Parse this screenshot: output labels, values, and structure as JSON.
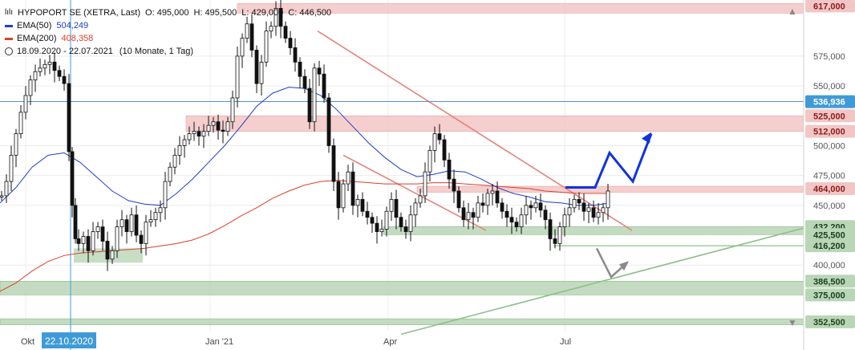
{
  "legend": {
    "logo": "lılı",
    "symbol": "HYPOPORT SE (XETRA, Last)",
    "open": "O: 495,000",
    "high": "H: 495,500",
    "low": "L: 429,000",
    "close": "C: 446,500",
    "ema50_label": "EMA(50)",
    "ema50_value": "504,249",
    "ema200_label": "EMA(200)",
    "ema200_value": "408,358",
    "date_range": "18.09.2020 - 22.07.2021",
    "period": "(10 Monate, 1 Tag)"
  },
  "colors": {
    "ema50": "#1f3fbf",
    "ema200": "#d9402a",
    "resistance_zone": "#f3c6c6",
    "support_zone": "#b9d6b6",
    "trend_red": "#e2857c",
    "trend_green": "#8fbf8a",
    "forecast_arrow": "#1133dd",
    "gray_arrow": "#8a8a8a",
    "candle": "#111111",
    "highlight_label": "#3f9bd8"
  },
  "chart_data": {
    "type": "candlestick",
    "x_ticks": [
      "Okt",
      "Jan '21",
      "Apr",
      "Jul"
    ],
    "crosshair_date": "22.10.2020",
    "y_ticks": [
      "575,000",
      "550,000",
      "500,000",
      "475,000",
      "450,000",
      "400,000"
    ],
    "y_range": [
      345,
      622
    ],
    "price_labels": [
      {
        "text": "617,000",
        "value": 617,
        "style": "red"
      },
      {
        "text": "536,936",
        "value": 536.9,
        "style": "blue"
      },
      {
        "text": "525,000",
        "value": 525,
        "style": "red"
      },
      {
        "text": "512,000",
        "value": 512,
        "style": "red"
      },
      {
        "text": "464,000",
        "value": 464,
        "style": "red"
      },
      {
        "text": "432,200",
        "value": 432.2,
        "style": "green"
      },
      {
        "text": "425,500",
        "value": 425.5,
        "style": "green"
      },
      {
        "text": "416,200",
        "value": 416.2,
        "style": "green"
      },
      {
        "text": "386,500",
        "value": 386.5,
        "style": "green"
      },
      {
        "text": "375,000",
        "value": 375,
        "style": "green"
      },
      {
        "text": "352,500",
        "value": 352.5,
        "style": "green"
      }
    ],
    "zones": [
      {
        "kind": "resistance",
        "low": 611,
        "high": 619
      },
      {
        "kind": "resistance",
        "low": 512,
        "high": 525
      },
      {
        "kind": "resistance",
        "low": 461,
        "high": 466
      },
      {
        "kind": "support",
        "low": 425.5,
        "high": 432.2
      },
      {
        "kind": "support",
        "low": 375,
        "high": 386.5
      },
      {
        "kind": "support",
        "low": 350,
        "high": 355
      }
    ],
    "ema50": [
      [
        0,
        452
      ],
      [
        20,
        465
      ],
      [
        40,
        482
      ],
      [
        60,
        492
      ],
      [
        80,
        494
      ],
      [
        100,
        486
      ],
      [
        120,
        474
      ],
      [
        140,
        462
      ],
      [
        160,
        454
      ],
      [
        180,
        451
      ],
      [
        200,
        450
      ],
      [
        220,
        460
      ],
      [
        240,
        472
      ],
      [
        260,
        486
      ],
      [
        280,
        500
      ],
      [
        300,
        516
      ],
      [
        320,
        533
      ],
      [
        340,
        544
      ],
      [
        360,
        549
      ],
      [
        380,
        548
      ],
      [
        400,
        542
      ],
      [
        420,
        530
      ],
      [
        440,
        516
      ],
      [
        460,
        502
      ],
      [
        480,
        490
      ],
      [
        500,
        480
      ],
      [
        520,
        474
      ],
      [
        540,
        476
      ],
      [
        560,
        479
      ],
      [
        580,
        478
      ],
      [
        600,
        472
      ],
      [
        620,
        465
      ],
      [
        640,
        460
      ],
      [
        660,
        457
      ],
      [
        680,
        453
      ],
      [
        700,
        452
      ],
      [
        720,
        450
      ],
      [
        740,
        450
      ],
      [
        760,
        452
      ]
    ],
    "ema200": [
      [
        0,
        378
      ],
      [
        20,
        385
      ],
      [
        40,
        395
      ],
      [
        60,
        403
      ],
      [
        80,
        408
      ],
      [
        100,
        410
      ],
      [
        120,
        411
      ],
      [
        140,
        412
      ],
      [
        160,
        413
      ],
      [
        180,
        414
      ],
      [
        200,
        416
      ],
      [
        220,
        418
      ],
      [
        240,
        421
      ],
      [
        260,
        426
      ],
      [
        280,
        433
      ],
      [
        300,
        441
      ],
      [
        320,
        448
      ],
      [
        340,
        456
      ],
      [
        360,
        462
      ],
      [
        380,
        467
      ],
      [
        400,
        470
      ],
      [
        420,
        471
      ],
      [
        440,
        470
      ],
      [
        460,
        469
      ],
      [
        480,
        468
      ],
      [
        500,
        468
      ],
      [
        520,
        468
      ],
      [
        540,
        469
      ],
      [
        560,
        469
      ],
      [
        580,
        468
      ],
      [
        600,
        467
      ],
      [
        620,
        466
      ],
      [
        640,
        465
      ],
      [
        660,
        464
      ],
      [
        680,
        462
      ],
      [
        700,
        461
      ],
      [
        720,
        460
      ],
      [
        740,
        460
      ],
      [
        760,
        460
      ]
    ],
    "closes": [
      [
        2,
        458
      ],
      [
        8,
        470
      ],
      [
        14,
        492
      ],
      [
        20,
        510
      ],
      [
        26,
        528
      ],
      [
        32,
        542
      ],
      [
        38,
        555
      ],
      [
        44,
        562
      ],
      [
        50,
        565
      ],
      [
        56,
        568
      ],
      [
        62,
        570
      ],
      [
        68,
        563
      ],
      [
        74,
        558
      ],
      [
        80,
        552
      ],
      [
        86,
        495
      ],
      [
        90,
        450
      ],
      [
        94,
        422
      ],
      [
        98,
        418
      ],
      [
        104,
        424
      ],
      [
        110,
        412
      ],
      [
        116,
        428
      ],
      [
        122,
        432
      ],
      [
        128,
        420
      ],
      [
        134,
        405
      ],
      [
        140,
        412
      ],
      [
        146,
        432
      ],
      [
        152,
        438
      ],
      [
        158,
        428
      ],
      [
        164,
        442
      ],
      [
        170,
        425
      ],
      [
        176,
        418
      ],
      [
        182,
        436
      ],
      [
        188,
        438
      ],
      [
        194,
        444
      ],
      [
        200,
        448
      ],
      [
        206,
        470
      ],
      [
        212,
        482
      ],
      [
        218,
        492
      ],
      [
        224,
        500
      ],
      [
        230,
        505
      ],
      [
        236,
        510
      ],
      [
        242,
        512
      ],
      [
        248,
        508
      ],
      [
        254,
        512
      ],
      [
        260,
        517
      ],
      [
        266,
        520
      ],
      [
        272,
        513
      ],
      [
        278,
        512
      ],
      [
        284,
        520
      ],
      [
        290,
        540
      ],
      [
        296,
        575
      ],
      [
        302,
        590
      ],
      [
        308,
        602
      ],
      [
        314,
        580
      ],
      [
        320,
        552
      ],
      [
        326,
        570
      ],
      [
        332,
        596
      ],
      [
        338,
        600
      ],
      [
        344,
        615
      ],
      [
        350,
        600
      ],
      [
        356,
        590
      ],
      [
        362,
        582
      ],
      [
        368,
        570
      ],
      [
        374,
        558
      ],
      [
        380,
        548
      ],
      [
        386,
        520
      ],
      [
        392,
        565
      ],
      [
        398,
        560
      ],
      [
        404,
        540
      ],
      [
        410,
        500
      ],
      [
        416,
        470
      ],
      [
        422,
        448
      ],
      [
        428,
        468
      ],
      [
        434,
        478
      ],
      [
        440,
        450
      ],
      [
        446,
        455
      ],
      [
        452,
        445
      ],
      [
        458,
        440
      ],
      [
        464,
        435
      ],
      [
        470,
        428
      ],
      [
        476,
        430
      ],
      [
        482,
        445
      ],
      [
        488,
        455
      ],
      [
        494,
        440
      ],
      [
        500,
        432
      ],
      [
        506,
        428
      ],
      [
        512,
        442
      ],
      [
        518,
        452
      ],
      [
        524,
        458
      ],
      [
        530,
        478
      ],
      [
        536,
        496
      ],
      [
        542,
        510
      ],
      [
        548,
        505
      ],
      [
        554,
        488
      ],
      [
        560,
        472
      ],
      [
        566,
        462
      ],
      [
        572,
        448
      ],
      [
        578,
        438
      ],
      [
        584,
        444
      ],
      [
        590,
        440
      ],
      [
        596,
        452
      ],
      [
        602,
        450
      ],
      [
        608,
        460
      ],
      [
        614,
        462
      ],
      [
        620,
        452
      ],
      [
        626,
        445
      ],
      [
        632,
        440
      ],
      [
        638,
        436
      ],
      [
        644,
        432
      ],
      [
        650,
        442
      ],
      [
        656,
        450
      ],
      [
        662,
        448
      ],
      [
        668,
        452
      ],
      [
        674,
        446
      ],
      [
        680,
        438
      ],
      [
        686,
        422
      ],
      [
        692,
        418
      ],
      [
        698,
        432
      ],
      [
        704,
        442
      ],
      [
        710,
        448
      ],
      [
        716,
        455
      ],
      [
        722,
        452
      ],
      [
        728,
        445
      ],
      [
        734,
        448
      ],
      [
        740,
        440
      ],
      [
        746,
        444
      ],
      [
        752,
        448
      ],
      [
        758,
        462
      ]
    ],
    "annotations": {
      "red_downtrend_long": [
        [
          396,
          596
        ],
        [
          788,
          429
        ]
      ],
      "red_downtrend_short": [
        [
          428,
          492
        ],
        [
          606,
          429
        ]
      ],
      "green_uptrend": [
        [
          500,
          342
        ],
        [
          1002,
          431
        ]
      ],
      "crosshair_price": 536.9,
      "forecast_arrow_path": [
        [
          705,
          465
        ],
        [
          742,
          465
        ],
        [
          760,
          494
        ],
        [
          789,
          470
        ],
        [
          812,
          510
        ]
      ],
      "gray_arrow_path": [
        [
          744,
          414
        ],
        [
          762,
          390
        ],
        [
          782,
          402
        ]
      ],
      "support_box_left": {
        "x0": 92,
        "x1": 178,
        "low": 402,
        "high": 414
      }
    }
  }
}
